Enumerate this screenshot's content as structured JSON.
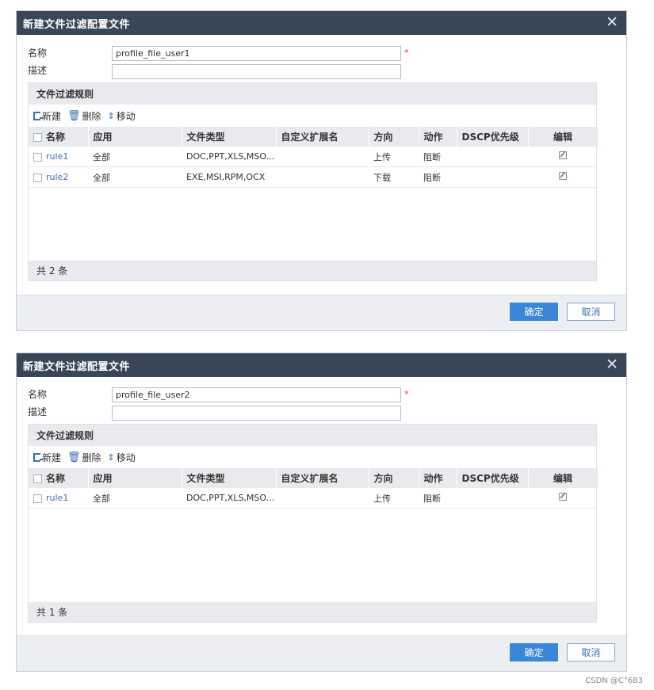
{
  "dialogs": [
    {
      "title": "新建文件过滤配置文件",
      "close": "✕",
      "name_label": "名称",
      "name_value": "profile_file_user1",
      "desc_label": "描述",
      "desc_value": "",
      "required_mark": "*",
      "rules_title": "文件过滤规则",
      "toolbar": {
        "new": "新建",
        "delete": "删除",
        "move": "移动"
      },
      "columns": [
        "名称",
        "应用",
        "文件类型",
        "自定义扩展名",
        "方向",
        "动作",
        "DSCP优先级",
        "编辑"
      ],
      "rows": [
        {
          "name": "rule1",
          "app": "全部",
          "filetype": "DOC,PPT,XLS,MSO...",
          "ext": "",
          "direction": "上传",
          "action": "阻断",
          "dscp": ""
        },
        {
          "name": "rule2",
          "app": "全部",
          "filetype": "EXE,MSI,RPM,OCX",
          "ext": "",
          "direction": "下载",
          "action": "阻断",
          "dscp": ""
        }
      ],
      "count_text": "共 2 条",
      "ok_label": "确定",
      "cancel_label": "取消"
    },
    {
      "title": "新建文件过滤配置文件",
      "close": "✕",
      "name_label": "名称",
      "name_value": "profile_file_user2",
      "desc_label": "描述",
      "desc_value": "",
      "required_mark": "*",
      "rules_title": "文件过滤规则",
      "toolbar": {
        "new": "新建",
        "delete": "删除",
        "move": "移动"
      },
      "columns": [
        "名称",
        "应用",
        "文件类型",
        "自定义扩展名",
        "方向",
        "动作",
        "DSCP优先级",
        "编辑"
      ],
      "rows": [
        {
          "name": "rule1",
          "app": "全部",
          "filetype": "DOC,PPT,XLS,MSO...",
          "ext": "",
          "direction": "上传",
          "action": "阻断",
          "dscp": ""
        }
      ],
      "count_text": "共 1 条",
      "ok_label": "确定",
      "cancel_label": "取消"
    }
  ],
  "watermark": "CSDN @C°683",
  "colors": {
    "titlebar": "#394658",
    "accent": "#3a86d8",
    "link": "#3a6fb5",
    "required": "#e33333"
  }
}
